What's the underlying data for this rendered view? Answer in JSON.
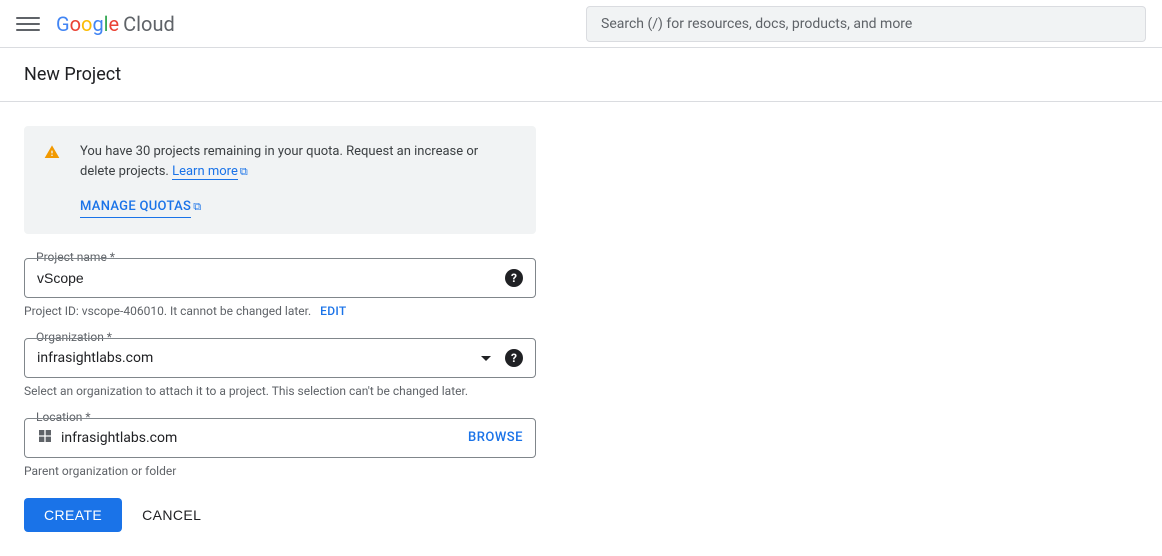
{
  "header": {
    "logo_cloud": "Cloud",
    "search_placeholder": "Search (/) for resources, docs, products, and more"
  },
  "page": {
    "title": "New Project"
  },
  "notice": {
    "text_before_link": "You have 30 projects remaining in your quota. Request an increase or delete projects. ",
    "learn_more": "Learn more",
    "manage_quotas": "MANAGE QUOTAS"
  },
  "project_name": {
    "label": "Project name *",
    "value": "vScope",
    "helper_before": "Project ID: vscope-406010. It cannot be changed later.",
    "edit": "EDIT"
  },
  "organization": {
    "label": "Organization *",
    "value": "infrasightlabs.com",
    "helper": "Select an organization to attach it to a project. This selection can't be changed later."
  },
  "location": {
    "label": "Location *",
    "value": "infrasightlabs.com",
    "browse": "BROWSE",
    "helper": "Parent organization or folder"
  },
  "actions": {
    "create": "CREATE",
    "cancel": "CANCEL"
  }
}
